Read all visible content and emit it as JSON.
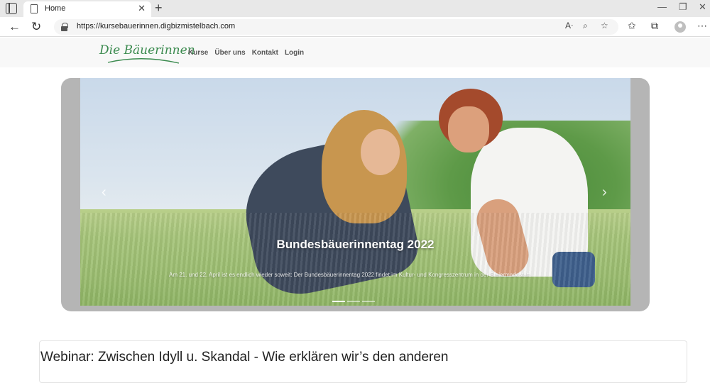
{
  "browser": {
    "tab_title": "Home",
    "url": "https://kursebauerinnen.digbizmistelbach.com",
    "new_tab_glyph": "+",
    "tab_close_glyph": "✕",
    "window_controls": [
      "—",
      "❐",
      "✕"
    ]
  },
  "site": {
    "logo_text": "Die Bäuerinnen",
    "nav": [
      "Kurse",
      "Über uns",
      "Kontakt",
      "Login"
    ]
  },
  "carousel": {
    "slide_title": "Bundesbäuerinnentag 2022",
    "slide_text": "Am 21. und 22. April ist es endlich wieder soweit: Der Bundesbäuerinnentag 2022 findet im Kultur- und Kongresszentrum in der Steiermark statt.",
    "prev_glyph": "‹",
    "next_glyph": "›",
    "indicator_count": 3,
    "active_indicator": 0
  },
  "card": {
    "title": "Webinar: Zwischen Idyll u. Skandal - Wie erklären wir’s den anderen"
  },
  "colors": {
    "brand_green": "#3a8a4e",
    "carousel_frame": "#b5b5b5"
  },
  "icons": [
    "tab-actions-icon",
    "page-icon",
    "back-arrow-icon",
    "refresh-icon",
    "lock-icon",
    "read-aloud-icon",
    "zoom-icon",
    "add-favorite-icon",
    "favorites-icon",
    "collections-icon",
    "profile-icon",
    "more-icon"
  ]
}
